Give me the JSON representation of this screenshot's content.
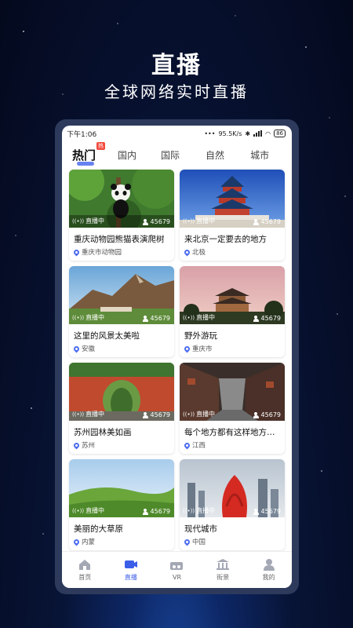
{
  "hero": {
    "title": "直播",
    "subtitle": "全球网络实时直播"
  },
  "status_bar": {
    "time": "下午1:06",
    "speed": "95.5K/s",
    "battery": "86"
  },
  "tabs": [
    {
      "label": "热门",
      "badge": "热",
      "active": true
    },
    {
      "label": "国内"
    },
    {
      "label": "国际"
    },
    {
      "label": "自然"
    },
    {
      "label": "城市"
    }
  ],
  "cards": [
    {
      "title": "重庆动物园熊猫表演爬树",
      "location": "重庆市动物园",
      "live": "直播中",
      "viewers": "45679"
    },
    {
      "title": "来北京一定要去的地方",
      "location": "北极",
      "live": "直播中",
      "viewers": "45679"
    },
    {
      "title": "这里的风景太美啦",
      "location": "安徽",
      "live": "直播中",
      "viewers": "45679"
    },
    {
      "title": "野外游玩",
      "location": "重庆市",
      "live": "直播中",
      "viewers": "45679"
    },
    {
      "title": "苏州园林美如画",
      "location": "苏州",
      "live": "直播中",
      "viewers": "45679"
    },
    {
      "title": "每个地方都有这样地方…",
      "location": "江西",
      "live": "直播中",
      "viewers": "45679"
    },
    {
      "title": "美丽的大草原",
      "location": "内蒙",
      "live": "直播中",
      "viewers": "45679"
    },
    {
      "title": "现代城市",
      "location": "中国",
      "live": "直播中",
      "viewers": "45679"
    }
  ],
  "bottom_nav": [
    {
      "label": "首页",
      "icon": "home-icon"
    },
    {
      "label": "直播",
      "icon": "video-camera-icon",
      "active": true
    },
    {
      "label": "VR",
      "icon": "vr-icon"
    },
    {
      "label": "街景",
      "icon": "landmark-icon"
    },
    {
      "label": "我的",
      "icon": "user-icon"
    }
  ],
  "colors": {
    "accent": "#3b5ee8",
    "badge": "#f24a3d",
    "phone_frame": "#2d3a5c",
    "background": "#081436"
  }
}
